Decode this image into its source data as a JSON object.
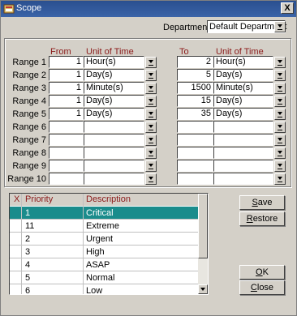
{
  "window": {
    "title": "Scope",
    "close_label": "X"
  },
  "department": {
    "label": "Department",
    "value": "Default Department"
  },
  "columns": {
    "from": "From",
    "unit_left": "Unit of Time",
    "to": "To",
    "unit_right": "Unit of Time"
  },
  "ranges": [
    {
      "label": "Range 1",
      "from": "1",
      "from_unit": "Hour(s)",
      "to": "2",
      "to_unit": "Hour(s)"
    },
    {
      "label": "Range 2",
      "from": "1",
      "from_unit": "Day(s)",
      "to": "5",
      "to_unit": "Day(s)"
    },
    {
      "label": "Range 3",
      "from": "1",
      "from_unit": "Minute(s)",
      "to": "1500",
      "to_unit": "Minute(s)"
    },
    {
      "label": "Range 4",
      "from": "1",
      "from_unit": "Day(s)",
      "to": "15",
      "to_unit": "Day(s)"
    },
    {
      "label": "Range 5",
      "from": "1",
      "from_unit": "Day(s)",
      "to": "35",
      "to_unit": "Day(s)"
    },
    {
      "label": "Range 6",
      "from": "",
      "from_unit": "",
      "to": "",
      "to_unit": ""
    },
    {
      "label": "Range 7",
      "from": "",
      "from_unit": "",
      "to": "",
      "to_unit": ""
    },
    {
      "label": "Range 8",
      "from": "",
      "from_unit": "",
      "to": "",
      "to_unit": ""
    },
    {
      "label": "Range 9",
      "from": "",
      "from_unit": "",
      "to": "",
      "to_unit": ""
    },
    {
      "label": "Range 10",
      "from": "",
      "from_unit": "",
      "to": "",
      "to_unit": ""
    }
  ],
  "grid": {
    "headers": {
      "x": "X",
      "priority": "Priority",
      "description": "Description"
    },
    "rows": [
      {
        "priority": "1",
        "description": "Critical",
        "selected": true
      },
      {
        "priority": "11",
        "description": "Extreme"
      },
      {
        "priority": "2",
        "description": "Urgent"
      },
      {
        "priority": "3",
        "description": "High"
      },
      {
        "priority": "4",
        "description": "ASAP"
      },
      {
        "priority": "5",
        "description": "Normal"
      },
      {
        "priority": "6",
        "description": "Low"
      }
    ]
  },
  "buttons": {
    "save": {
      "key": "S",
      "rest": "ave"
    },
    "restore": {
      "key": "R",
      "rest": "estore"
    },
    "ok": {
      "key": "O",
      "rest": "K"
    },
    "close": {
      "key": "C",
      "rest": "lose"
    }
  },
  "colors": {
    "selected_row": "#1a8c8c",
    "title_bar": "#2a4f8f",
    "header_text": "#8b1a1a"
  }
}
